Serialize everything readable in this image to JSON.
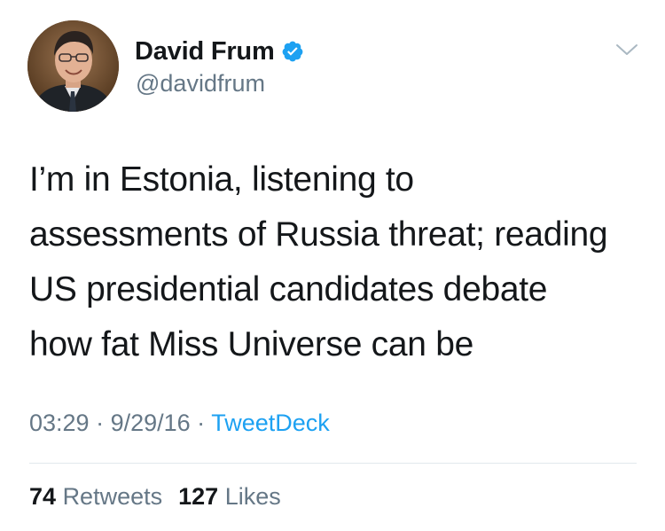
{
  "user": {
    "display_name": "David Frum",
    "handle": "@davidfrum",
    "verified": true,
    "avatar_icon": "profile-photo"
  },
  "tweet": {
    "text_lines": [
      "I’m in Estonia, listening to",
      "assessments of Russia threat; reading",
      "US presidential candidates debate",
      "how fat Miss Universe can be"
    ],
    "time": "03:29",
    "sep1": " · ",
    "date": "9/29/16",
    "sep2": " · ",
    "source": "TweetDeck"
  },
  "stats": {
    "retweets_count": "74",
    "retweets_label": "Retweets",
    "likes_count": "127",
    "likes_label": "Likes"
  },
  "colors": {
    "text": "#14171a",
    "secondary": "#657786",
    "link": "#1da1f2",
    "verified": "#1da1f2",
    "divider": "#e1e8ed"
  },
  "icons": {
    "verified": "verified-badge-icon",
    "menu": "chevron-down-icon"
  }
}
